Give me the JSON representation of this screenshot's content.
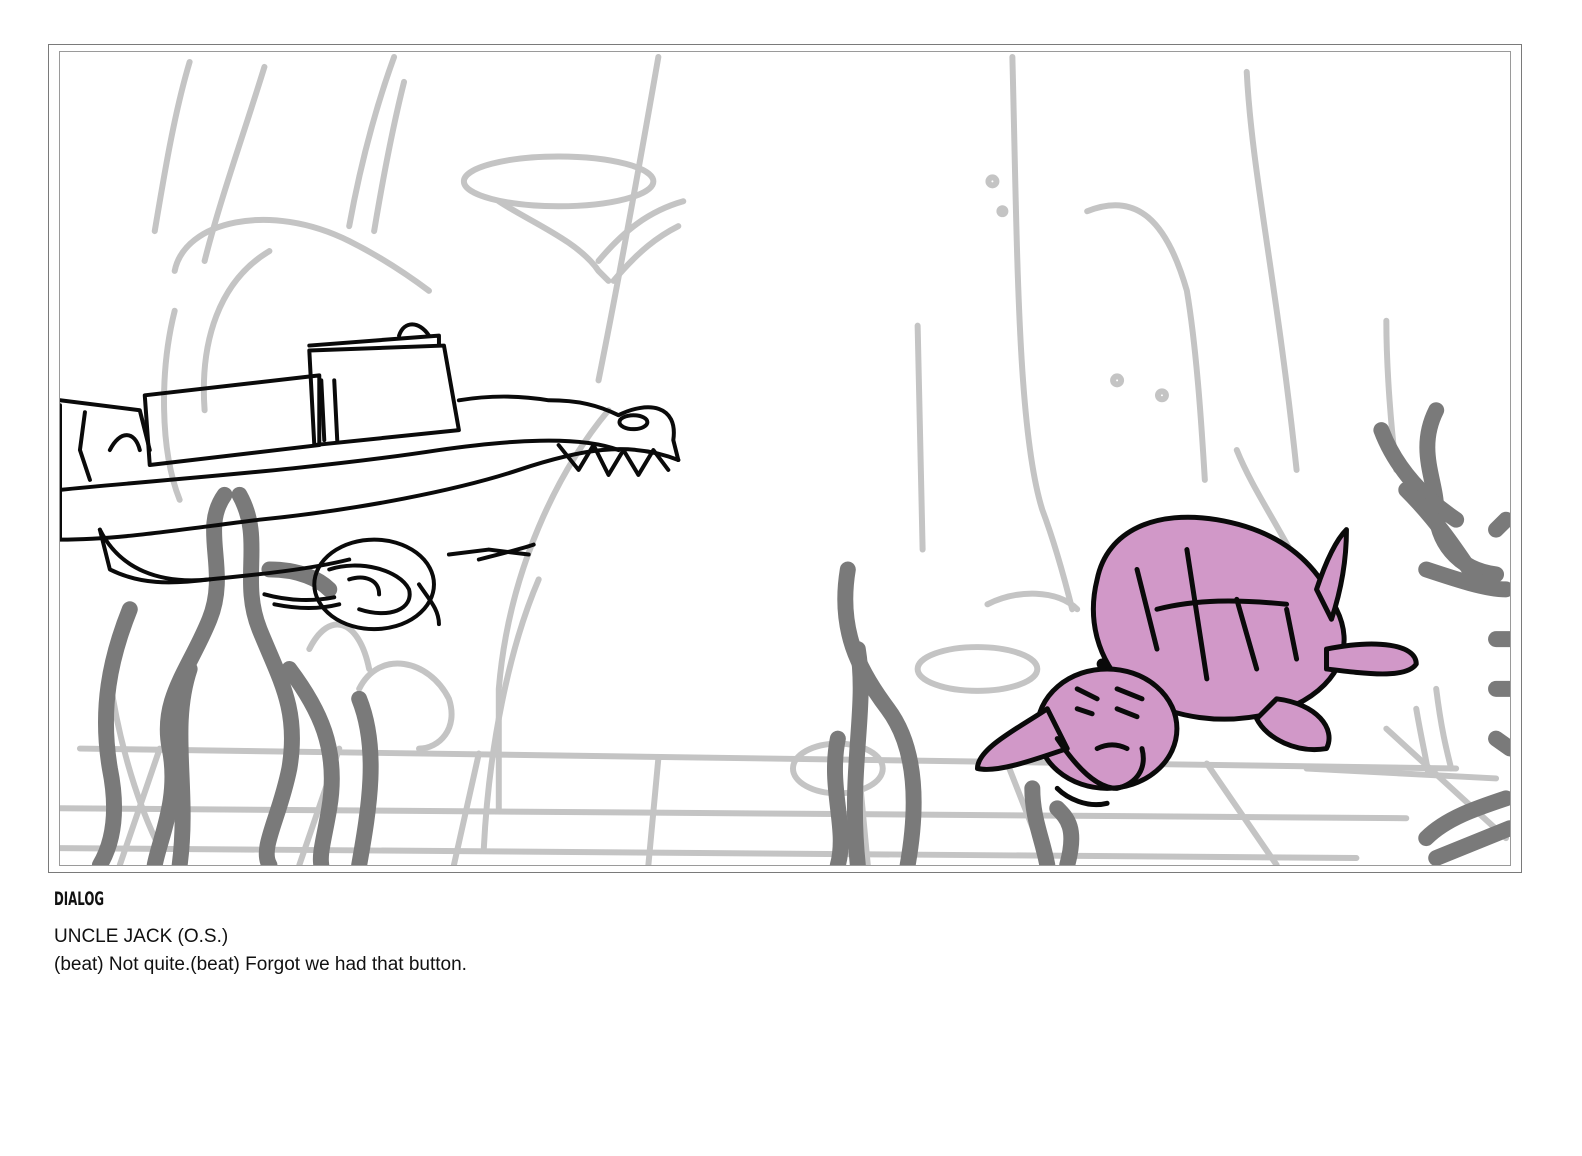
{
  "panel": {
    "colors": {
      "background_sketch": "#c4c4c4",
      "seaweed": "#7a7a7a",
      "ink": "#0a0a0a",
      "turtle_fill": "#d198c8"
    }
  },
  "dialog": {
    "heading": "DIALOG",
    "speaker": "UNCLE JACK (O.S.)",
    "line": "(beat) Not quite.(beat) Forgot we had that button."
  }
}
